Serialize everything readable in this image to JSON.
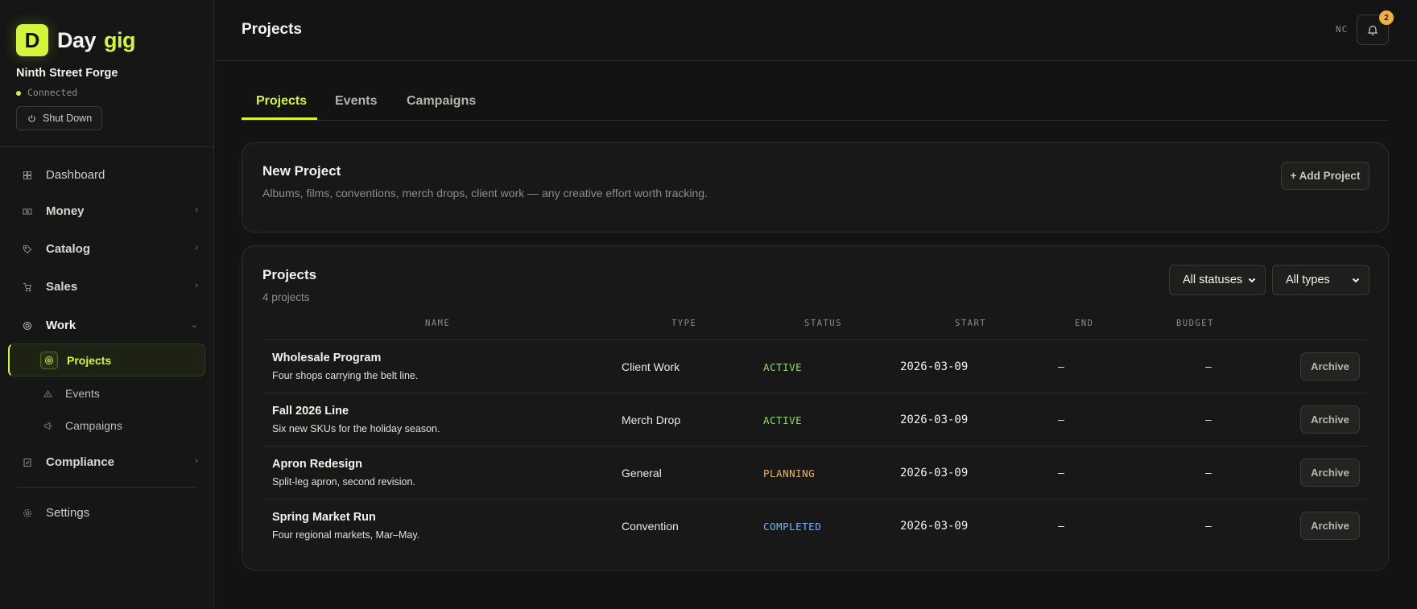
{
  "brand": {
    "mark": "D",
    "word1": "Day",
    "word2": "gig"
  },
  "org": {
    "name": "Ninth Street Forge",
    "status": "Connected",
    "shutdown_label": "Shut Down"
  },
  "nav": {
    "dashboard": "Dashboard",
    "money": "Money",
    "catalog": "Catalog",
    "sales": "Sales",
    "work": "Work",
    "work_sub": {
      "projects": "Projects",
      "events": "Events",
      "campaigns": "Campaigns"
    },
    "compliance": "Compliance",
    "settings": "Settings"
  },
  "header": {
    "title": "Projects",
    "user_initials": "NC",
    "notification_count": "2"
  },
  "tabs": [
    {
      "label": "Projects",
      "active": true
    },
    {
      "label": "Events",
      "active": false
    },
    {
      "label": "Campaigns",
      "active": false
    }
  ],
  "new_project": {
    "title": "New Project",
    "description": "Albums, films, conventions, merch drops, client work — any creative effort worth tracking.",
    "add_label": "+ Add Project"
  },
  "projects": {
    "title": "Projects",
    "count": "4 projects",
    "filters": {
      "status": "All statuses",
      "type": "All types"
    },
    "columns": {
      "name": "NAME",
      "type": "TYPE",
      "status": "STATUS",
      "start": "START",
      "end": "END",
      "budget": "BUDGET"
    },
    "archive_label": "Archive",
    "status_colors": {
      "ACTIVE": "#8fd96b",
      "PLANNING": "#f0b25c",
      "COMPLETED": "#7fb0f0"
    },
    "rows": [
      {
        "name": "Wholesale Program",
        "desc": "Four shops carrying the belt line.",
        "type": "Client Work",
        "status": "ACTIVE",
        "start": "2026-03-09",
        "end": "–",
        "budget": "–"
      },
      {
        "name": "Fall 2026 Line",
        "desc": "Six new SKUs for the holiday season.",
        "type": "Merch Drop",
        "status": "ACTIVE",
        "start": "2026-03-09",
        "end": "–",
        "budget": "–"
      },
      {
        "name": "Apron Redesign",
        "desc": "Split-leg apron, second revision.",
        "type": "General",
        "status": "PLANNING",
        "start": "2026-03-09",
        "end": "–",
        "budget": "–"
      },
      {
        "name": "Spring Market Run",
        "desc": "Four regional markets, Mar–May.",
        "type": "Convention",
        "status": "COMPLETED",
        "start": "2026-03-09",
        "end": "–",
        "budget": "–"
      }
    ]
  },
  "colors": {
    "accent": "#d4f53c",
    "badge": "#f2b23a"
  }
}
